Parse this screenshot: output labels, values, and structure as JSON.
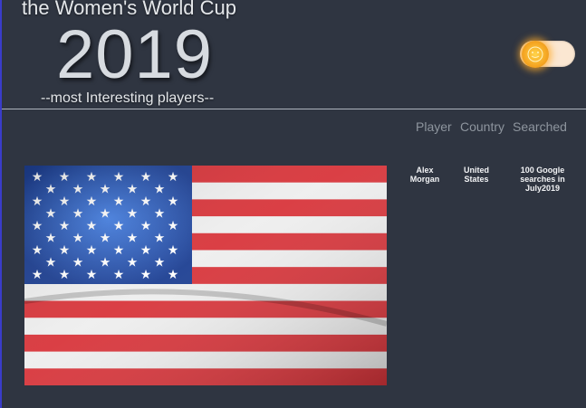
{
  "header": {
    "title_top": "the Women's World Cup",
    "year": "2019",
    "subtitle": "--most Interesting players--"
  },
  "theme_toggle": {
    "state": "light",
    "icon": "sun-icon"
  },
  "table": {
    "headers": [
      "Player",
      "Country",
      "Searched"
    ],
    "rows": [
      {
        "player": "Alex Morgan",
        "country": "United States",
        "searched": "100 Google searches in July2019"
      }
    ]
  },
  "image": {
    "subject": "flag-of-united-states"
  },
  "colors": {
    "background": "#2f3541",
    "flag_red": "#d8353b",
    "flag_blue": "#2f5fbf"
  }
}
